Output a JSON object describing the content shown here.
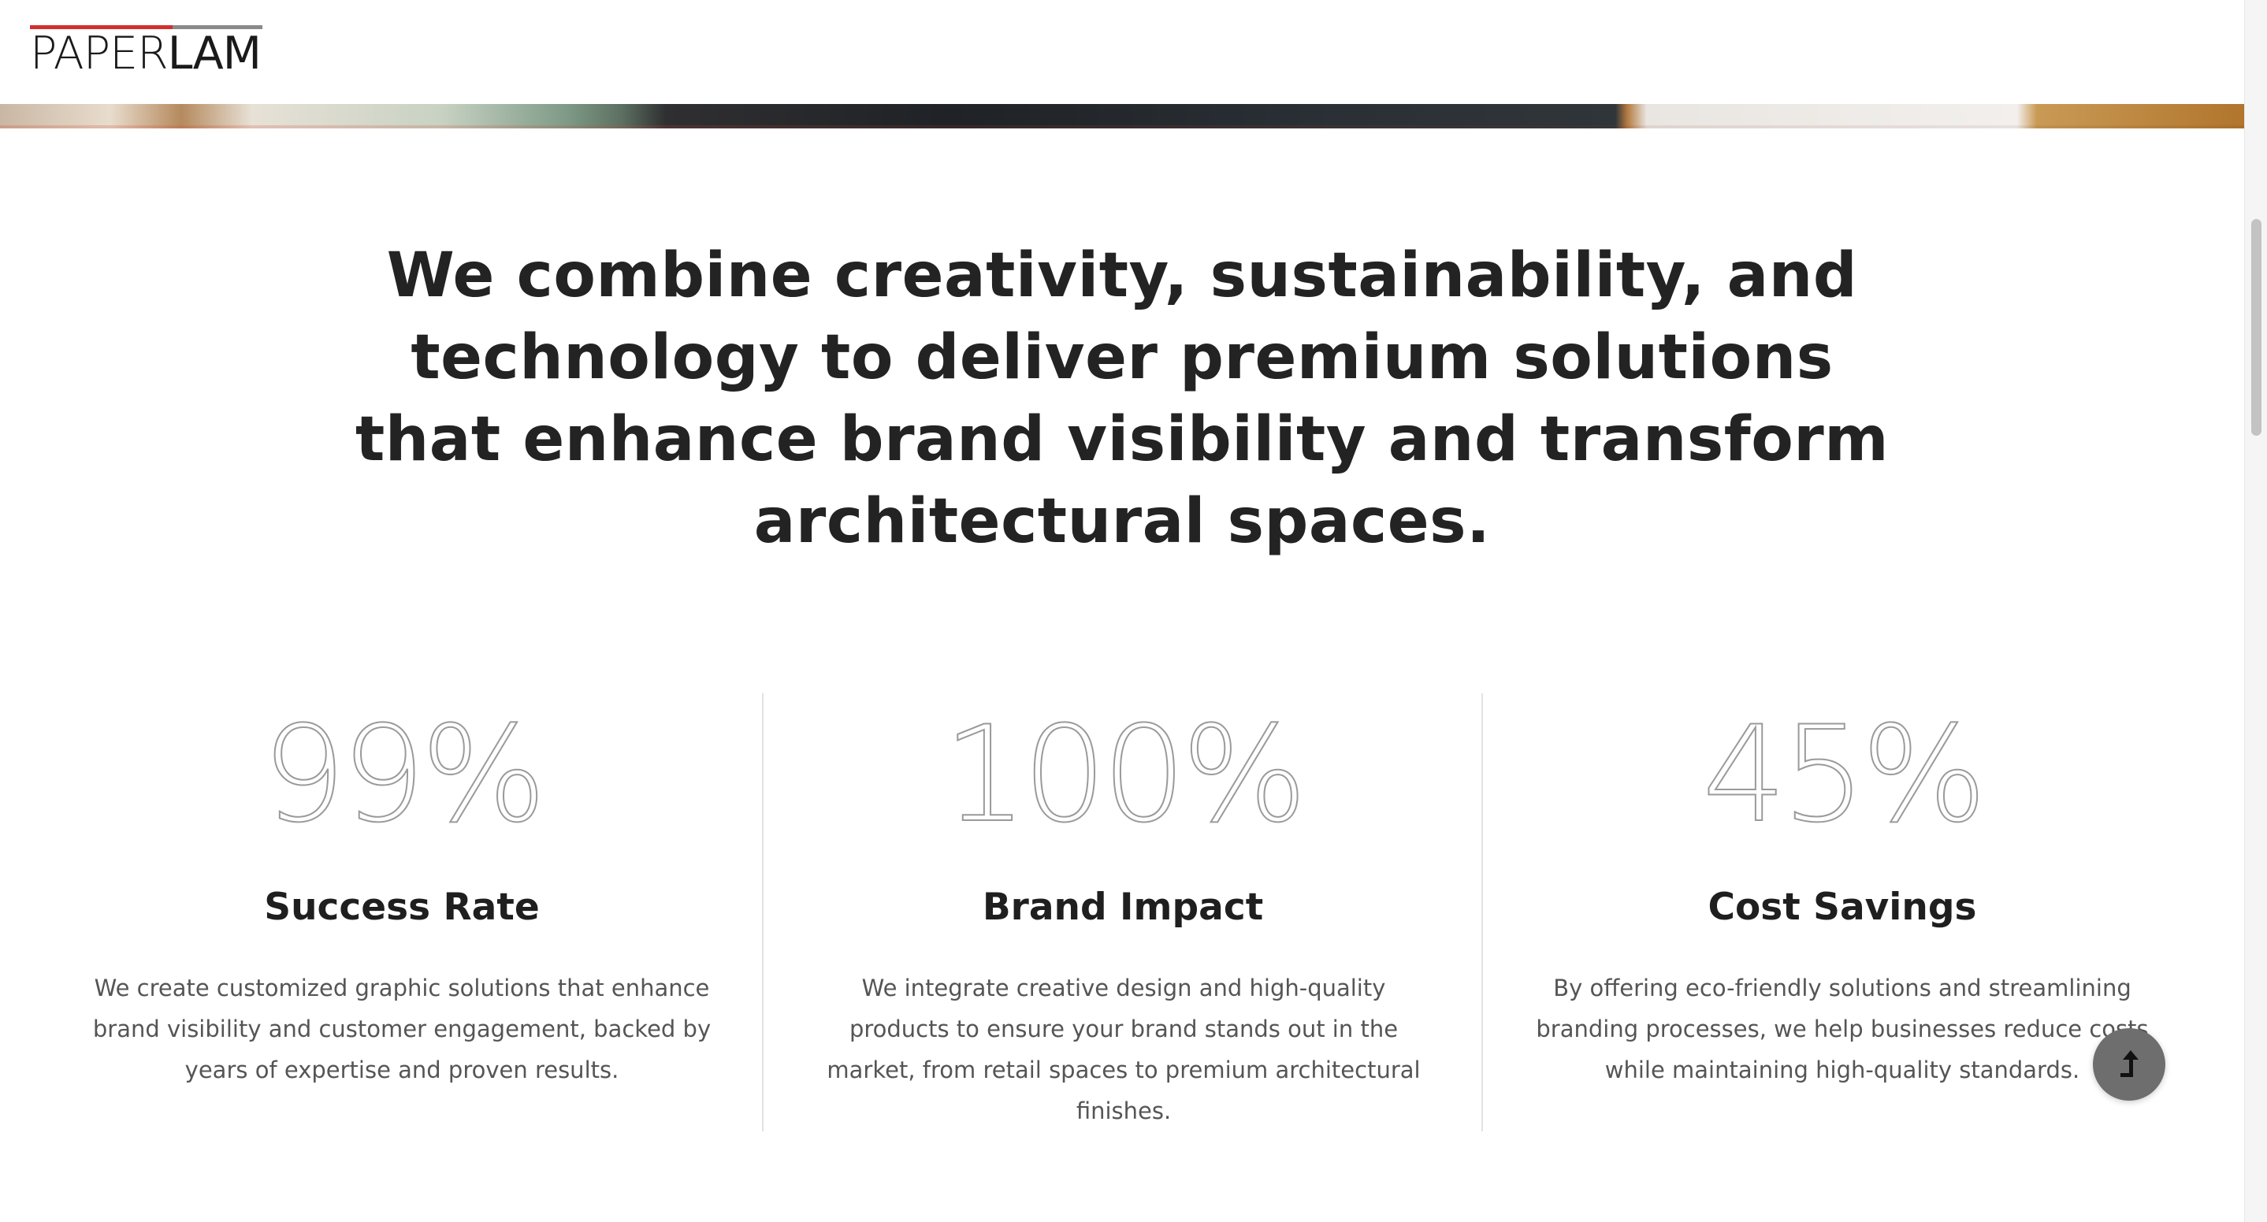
{
  "header": {
    "logo": {
      "text_light": "PAPER",
      "text_bold": "LAM",
      "accent_colors": [
        "#d12f2f",
        "#8a8a8a"
      ]
    }
  },
  "main": {
    "headline": "We combine creativity, sustainability, and technology to deliver premium solutions that enhance brand visibility and transform architectural spaces.",
    "stats": [
      {
        "value": "99%",
        "title": "Success Rate",
        "description": "We create customized graphic solutions that enhance brand visibility and customer engagement, backed by years of expertise and proven results."
      },
      {
        "value": "100%",
        "title": "Brand Impact",
        "description": "We integrate creative design and high-quality products to ensure your brand stands out in the market, from retail spaces to premium architectural finishes."
      },
      {
        "value": "45%",
        "title": "Cost Savings",
        "description": "By offering eco-friendly solutions and streamlining branding processes, we help businesses reduce costs while maintaining high-quality standards."
      }
    ]
  },
  "controls": {
    "back_to_top_icon": "arrow-up-icon"
  },
  "colors": {
    "text": "#222222",
    "muted_text": "#555555",
    "divider": "#e2e2e2",
    "button": "#6e6e6e"
  }
}
